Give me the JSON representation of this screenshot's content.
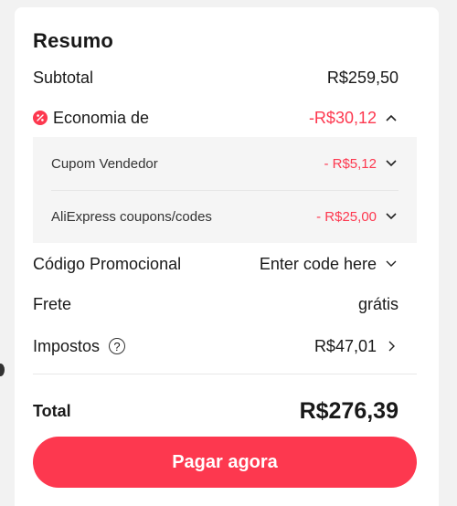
{
  "summary": {
    "title": "Resumo",
    "subtotal_label": "Subtotal",
    "subtotal_value": "R$259,50",
    "savings_label": "Economia de",
    "savings_value": "-R$30,12",
    "coupons": [
      {
        "label": "Cupom Vendedor",
        "value": "- R$5,12"
      },
      {
        "label": "AliExpress coupons/codes",
        "value": "- R$25,00"
      }
    ],
    "promo_label": "Código Promocional",
    "promo_placeholder": "Enter code here",
    "shipping_label": "Frete",
    "shipping_value": "grátis",
    "taxes_label": "Impostos",
    "taxes_value": "R$47,01",
    "total_label": "Total",
    "total_value": "R$276,39"
  },
  "actions": {
    "pay_label": "Pagar agora"
  },
  "colors": {
    "accent": "#fd384f",
    "background": "#f2f2f2",
    "card": "#ffffff",
    "panel": "#f5f5f5"
  },
  "icons": {
    "savings": "discount-badge-icon",
    "collapse": "chevron-up-icon",
    "expand": "chevron-down-icon",
    "help": "question-circle-icon",
    "navigate": "chevron-right-icon"
  }
}
